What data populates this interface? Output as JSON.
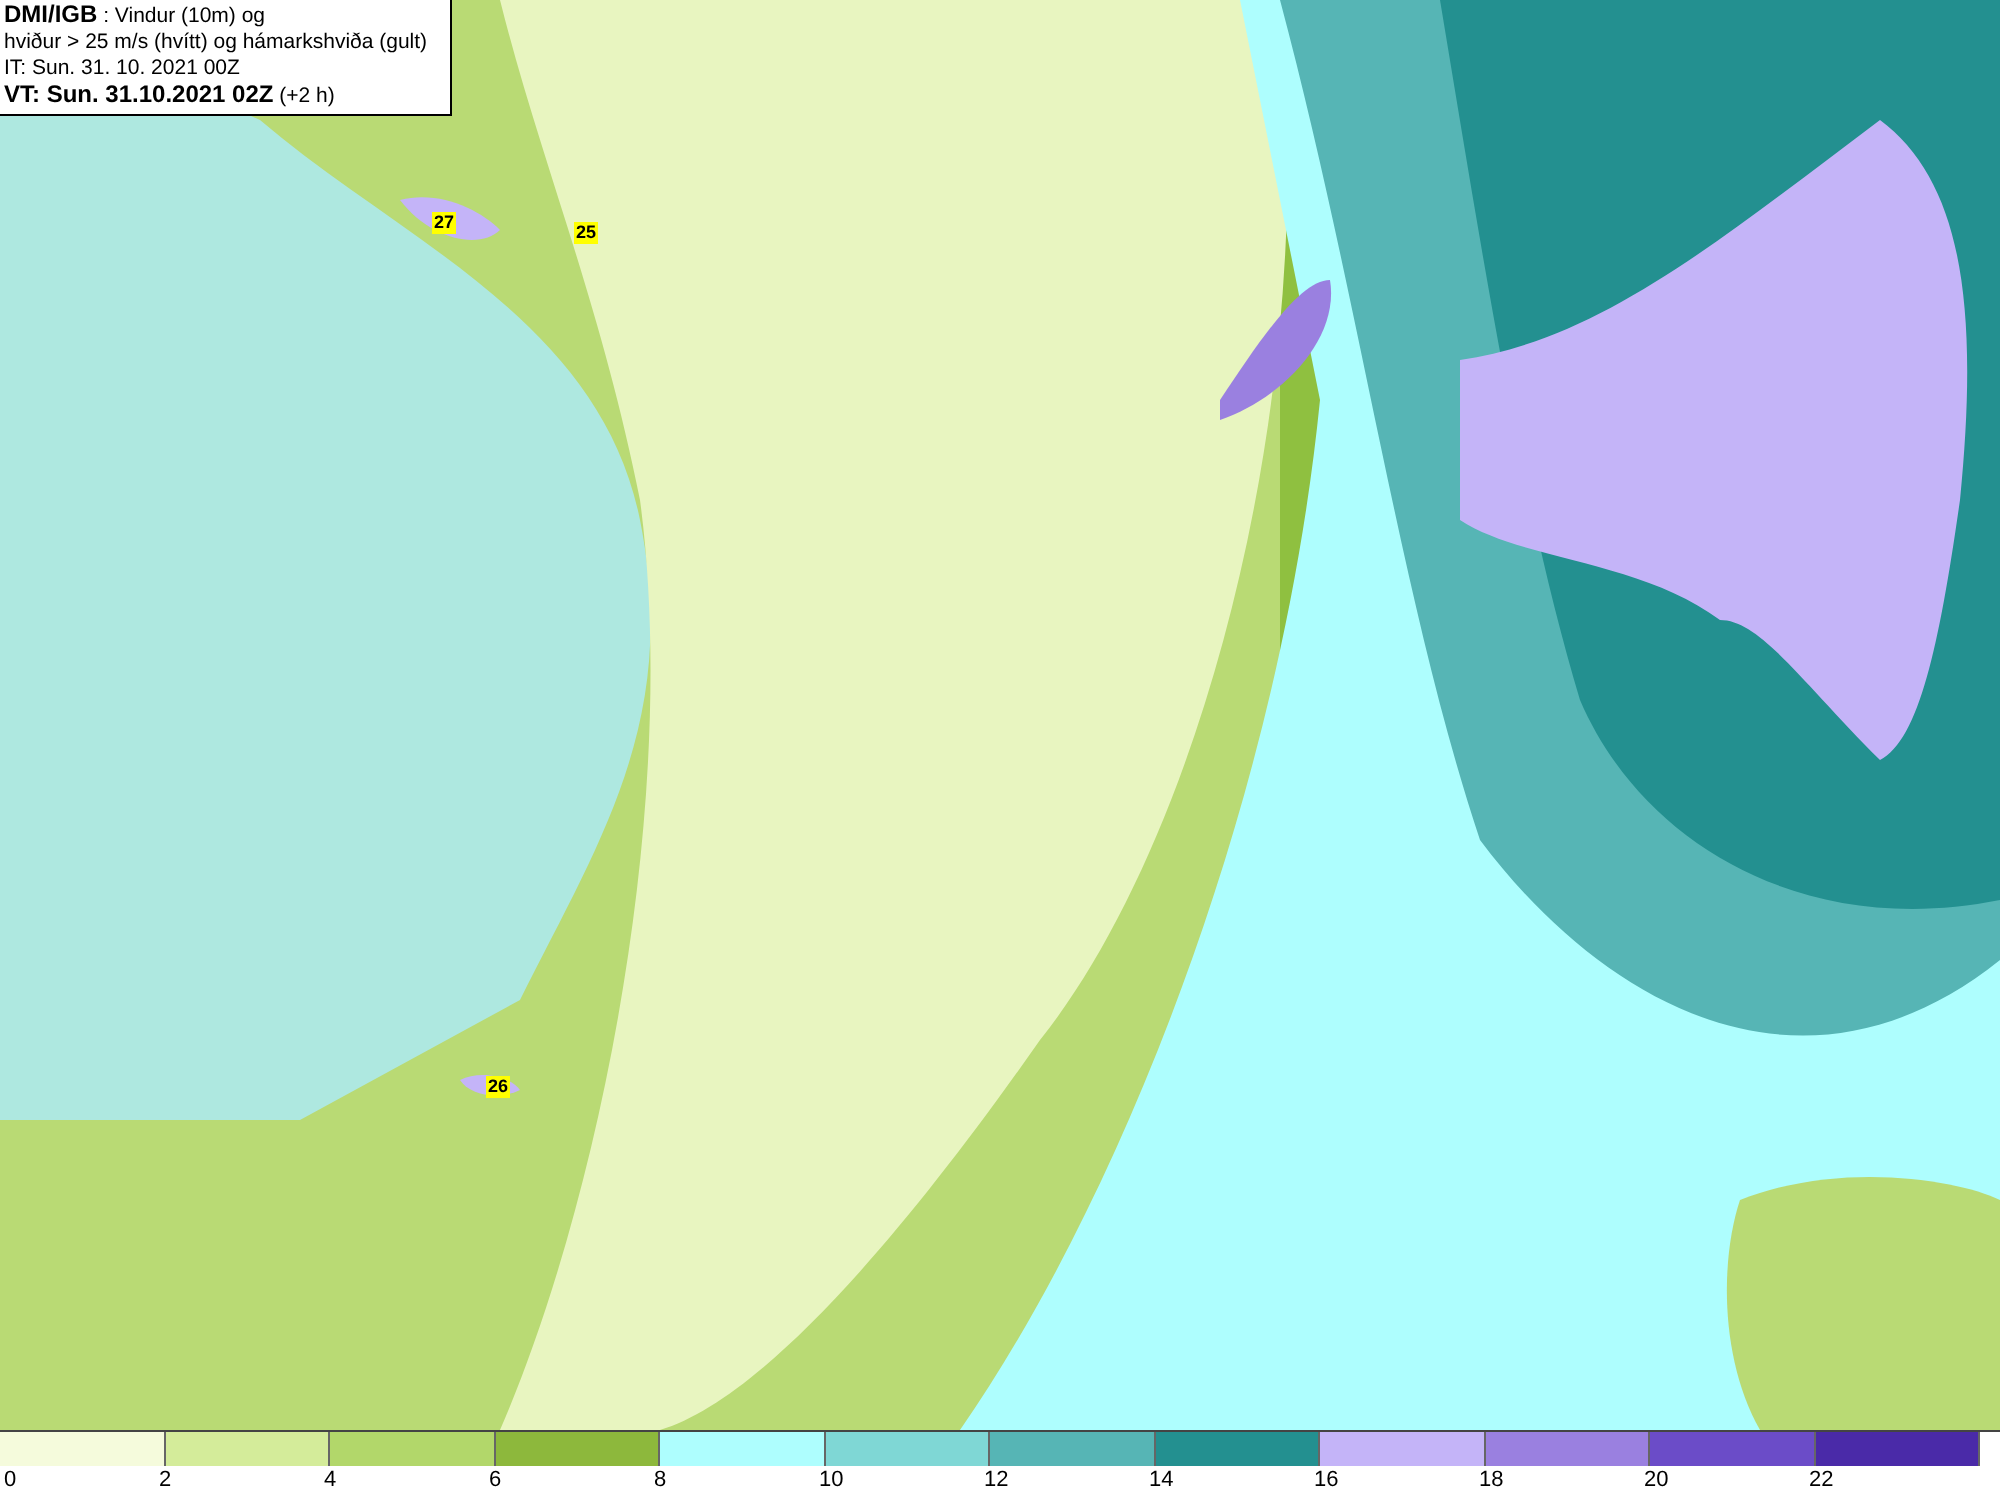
{
  "header": {
    "title": "**DMI/IGB** : Vindur (10m) og",
    "subtitle": "hviður > 25 m/s (hvítt) og hámarkshviða (gult)",
    "initial_time": "IT: Sun. 31. 10. 2021 00Z",
    "valid_time": "**VT: Sun. 31.10.2021 02Z** (+2 h)"
  },
  "map": {
    "gust_labels": [
      {
        "text": "27",
        "color": "#ffff00"
      },
      {
        "text": "25",
        "color": "#ffff00"
      },
      {
        "text": "26",
        "color": "#ffff00"
      }
    ]
  },
  "legend": {
    "bins": [
      {
        "color": "#f5fbdc"
      },
      {
        "color": "#d4ec9a"
      },
      {
        "color": "#b2d76a"
      },
      {
        "color": "#8db83c"
      },
      {
        "color": "#aefefe"
      },
      {
        "color": "#7fd7d5"
      },
      {
        "color": "#56b5b5"
      },
      {
        "color": "#239090"
      },
      {
        "color": "#c4b4f8"
      },
      {
        "color": "#9a80e0"
      },
      {
        "color": "#6b4cc8"
      },
      {
        "color": "#4a2aa8"
      }
    ],
    "ticks": [
      "0",
      "2",
      "4",
      "6",
      "8",
      "10",
      "12",
      "14",
      "16",
      "18",
      "20",
      "22"
    ]
  }
}
